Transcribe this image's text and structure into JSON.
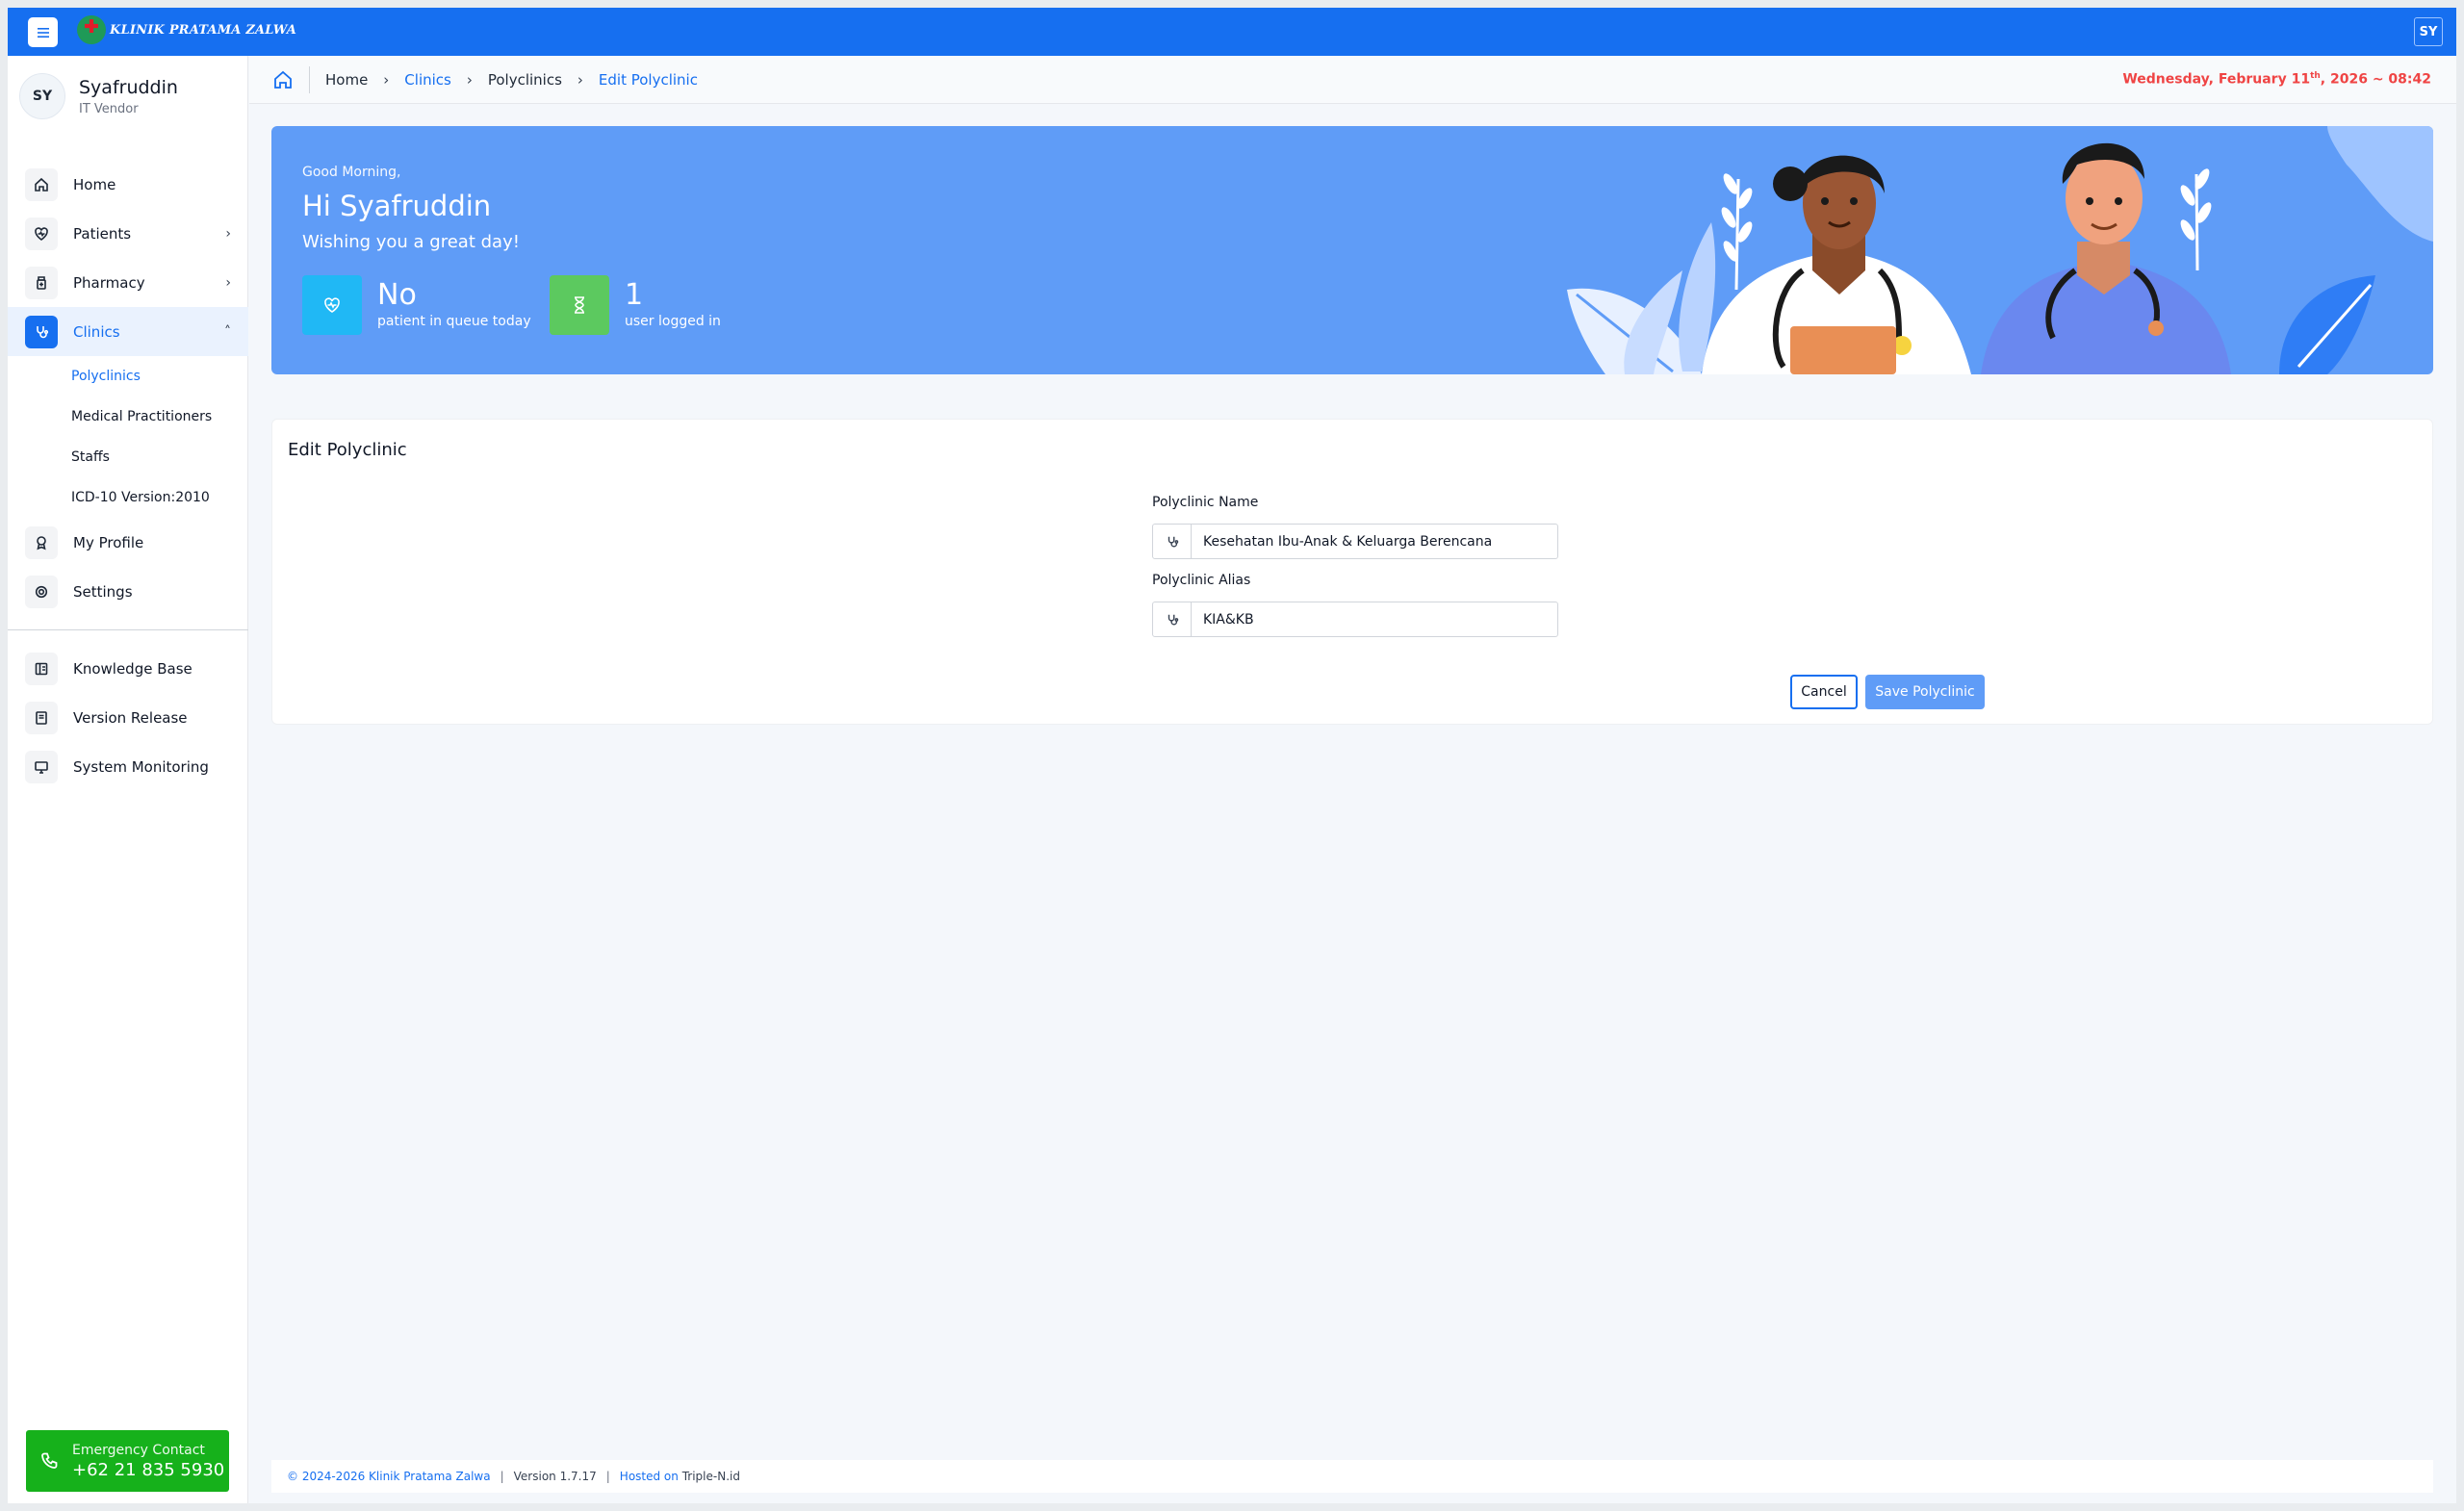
{
  "header": {
    "brand": "KLINIK PRATAMA ZALWA",
    "user_initials": "SY"
  },
  "sidebar": {
    "user": {
      "initials": "SY",
      "name": "Syafruddin",
      "role": "IT Vendor"
    },
    "items": [
      {
        "label": "Home",
        "icon": "home-icon"
      },
      {
        "label": "Patients",
        "icon": "heart-icon"
      },
      {
        "label": "Pharmacy",
        "icon": "medicine-icon"
      },
      {
        "label": "Clinics",
        "icon": "stethoscope-icon"
      }
    ],
    "clinics_sub": [
      "Polyclinics",
      "Medical Practitioners",
      "Staffs",
      "ICD-10 Version:2010"
    ],
    "items2": [
      {
        "label": "My Profile",
        "icon": "badge-icon"
      },
      {
        "label": "Settings",
        "icon": "gear-icon"
      }
    ],
    "items3": [
      {
        "label": "Knowledge Base",
        "icon": "book-icon"
      },
      {
        "label": "Version Release",
        "icon": "notebook-icon"
      },
      {
        "label": "System Monitoring",
        "icon": "monitor-icon"
      }
    ],
    "emergency": {
      "label": "Emergency Contact",
      "number": "+62 21 835 5930"
    }
  },
  "breadcrumb": {
    "items": [
      "Home",
      "Clinics",
      "Polyclinics",
      "Edit Polyclinic"
    ],
    "date_main": "Wednesday, February 11",
    "date_sup": "th",
    "date_rest": ", 2026 ~ 08:42"
  },
  "banner": {
    "greeting": "Good Morning,",
    "title": "Hi Syafruddin",
    "subtitle": "Wishing you a great day!",
    "stats": [
      {
        "value": "No",
        "label": "patient in queue today",
        "color": "#20b8f5"
      },
      {
        "value": "1",
        "label": "user logged in",
        "color": "#5cc95f"
      }
    ]
  },
  "form": {
    "title": "Edit Polyclinic",
    "name_label": "Polyclinic Name",
    "name_value": "Kesehatan Ibu-Anak & Keluarga Berencana",
    "alias_label": "Polyclinic Alias",
    "alias_value": "KIA&KB",
    "cancel_label": "Cancel",
    "save_label": "Save Polyclinic"
  },
  "footer": {
    "copyright": "© 2024-2026 Klinik Pratama Zalwa",
    "version": "Version 1.7.17",
    "hosted_label": "Hosted on",
    "hosted_value": "Triple-N.id"
  }
}
